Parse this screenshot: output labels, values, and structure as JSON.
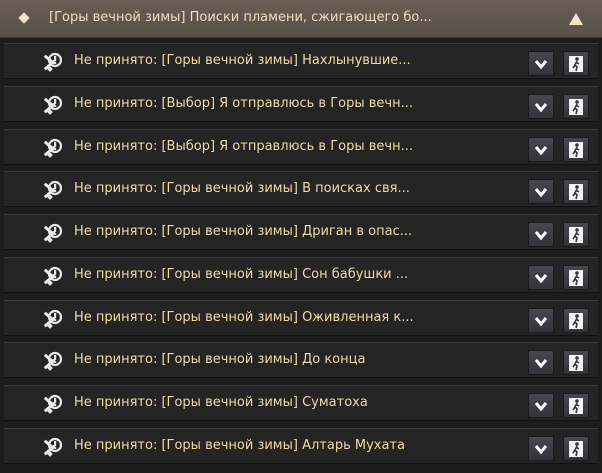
{
  "header": {
    "title": "[Горы вечной зимы] Поиски пламени, сжигающего бо...",
    "collapse_icon": "triangle-up-icon"
  },
  "quests": [
    {
      "label": "Не принято: [Горы вечной зимы] Нахлынувшие..."
    },
    {
      "label": "Не принято: [Выбор] Я отправлюсь в Горы вечн..."
    },
    {
      "label": "Не принято: [Выбор] Я отправлюсь в Горы вечн..."
    },
    {
      "label": "Не принято: [Горы вечной зимы] В поисках свя..."
    },
    {
      "label": "Не принято: [Горы вечной зимы] Дриган в опас..."
    },
    {
      "label": "Не принято: [Горы вечной зимы] Сон бабушки ..."
    },
    {
      "label": "Не принято: [Горы вечной зимы] Оживленная к..."
    },
    {
      "label": "Не принято: [Горы вечной зимы] До конца"
    },
    {
      "label": "Не принято: [Горы вечной зимы] Суматоха"
    },
    {
      "label": "Не принято: [Горы вечной зимы] Алтарь Мухата"
    }
  ],
  "icons": {
    "quest": "quest-not-accepted-icon",
    "dropdown": "chevron-down-icon",
    "auto_move": "walking-man-icon"
  }
}
